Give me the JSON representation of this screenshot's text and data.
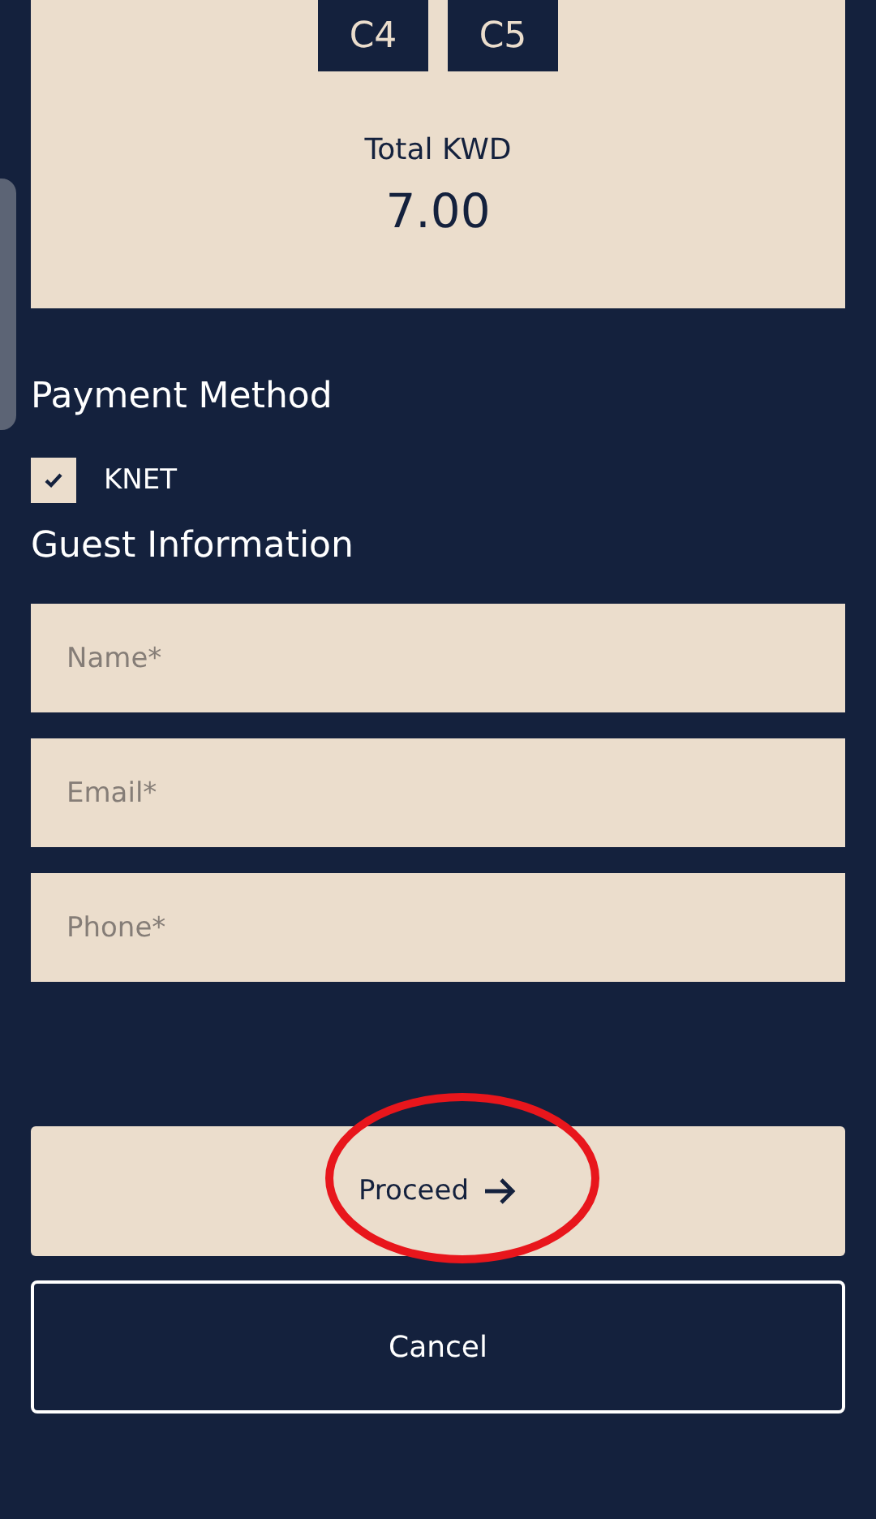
{
  "summary": {
    "seats": [
      "C4",
      "C5"
    ],
    "total_label": "Total KWD",
    "total_value": "7.00"
  },
  "payment": {
    "title": "Payment Method",
    "options": [
      {
        "label": "KNET",
        "checked": true
      }
    ]
  },
  "guest": {
    "title": "Guest Information",
    "fields": [
      {
        "placeholder": "Name*"
      },
      {
        "placeholder": "Email*"
      },
      {
        "placeholder": "Phone*"
      }
    ]
  },
  "proceed_button": {
    "label": "Proceed",
    "circled": true
  },
  "cancel_button": {
    "label": "Cancel"
  }
}
